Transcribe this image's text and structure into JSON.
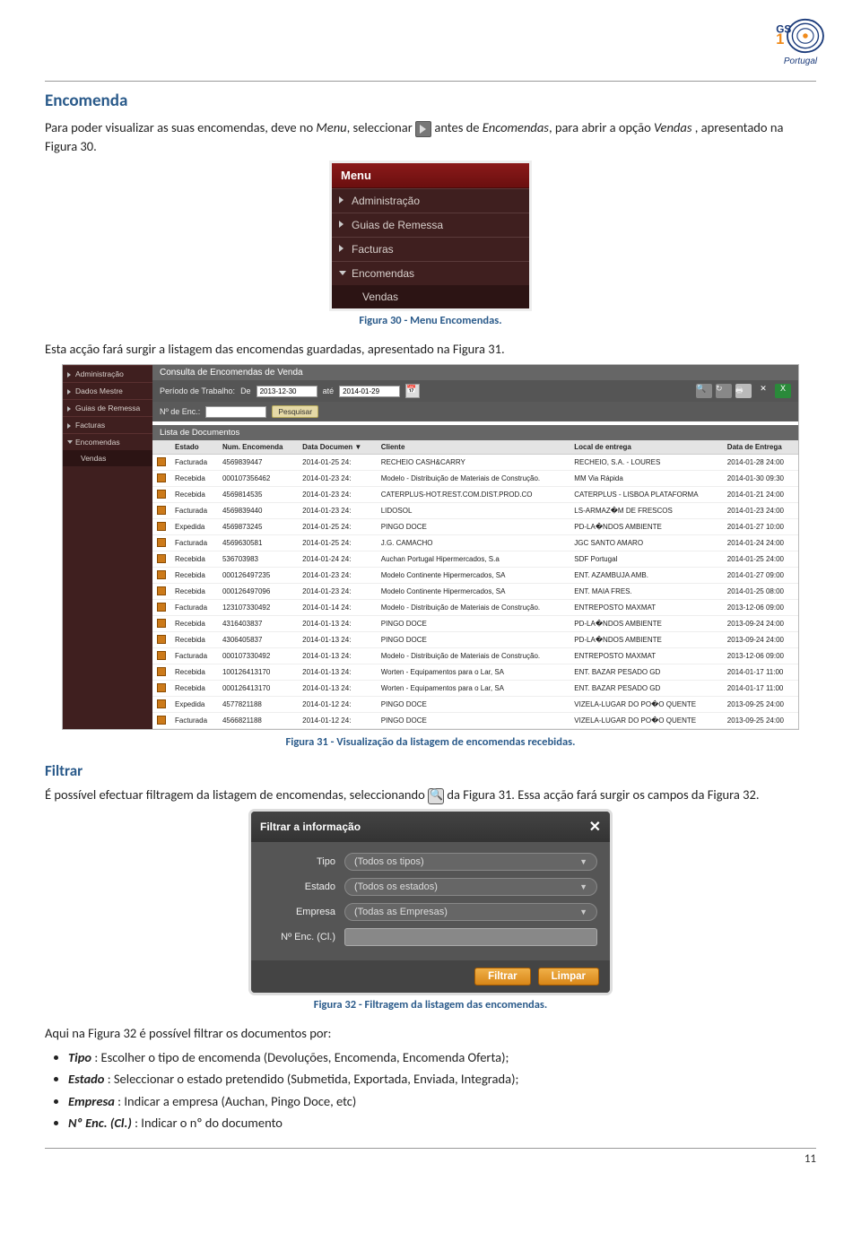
{
  "logo": {
    "brand": "GS1",
    "country": "Portugal"
  },
  "h_encomenda": "Encomenda",
  "p1_a": "Para poder visualizar as suas encomendas, deve no ",
  "p1_menu": "Menu",
  "p1_b": ", seleccionar ",
  "p1_c": " antes de ",
  "p1_enc": "Encomendas",
  "p1_d": ", para abrir a opção ",
  "p1_vendas": "Vendas ",
  "p1_e": ", apresentado na Figura 30.",
  "menu": {
    "title": "Menu",
    "items": [
      "Administração",
      "Guias de Remessa",
      "Facturas",
      "Encomendas"
    ],
    "sub": "Vendas"
  },
  "cap30": "Figura 30 - Menu Encomendas.",
  "p2": "Esta acção fará surgir a listagem das encomendas guardadas, apresentado na Figura 31.",
  "listing": {
    "title": "Consulta de Encomendas de Venda",
    "periodo_lbl": "Período de Trabalho:",
    "de_lbl": "De",
    "de_val": "2013-12-30",
    "ate_lbl": "até",
    "ate_val": "2014-01-29",
    "nenc_lbl": "Nº de Enc.:",
    "btn": "Pesquisar",
    "list_head": "Lista de Documentos",
    "cols": [
      "Estado",
      "Num. Encomenda",
      "Data Documen ▼",
      "Cliente",
      "Local de entrega",
      "Data de Entrega"
    ],
    "side": [
      "Administração",
      "Dados Mestre",
      "Guias de Remessa",
      "Facturas",
      "Encomendas"
    ],
    "side_sub": "Vendas",
    "rows": [
      [
        "Facturada",
        "4569839447",
        "2014-01-25 24:",
        "RECHEIO CASH&CARRY",
        "RECHEIO, S.A. - LOURES",
        "2014-01-28 24:00"
      ],
      [
        "Recebida",
        "000107356462",
        "2014-01-23 24:",
        "Modelo - Distribuição de Materiais de Construção.",
        "MM Via Rápida",
        "2014-01-30 09:30"
      ],
      [
        "Recebida",
        "4569814535",
        "2014-01-23 24:",
        "CATERPLUS-HOT.REST.COM.DIST.PROD.CO",
        "CATERPLUS - LISBOA PLATAFORMA",
        "2014-01-21 24:00"
      ],
      [
        "Facturada",
        "4569839440",
        "2014-01-23 24:",
        "LIDOSOL",
        "LS-ARMAZ�M DE FRESCOS",
        "2014-01-23 24:00"
      ],
      [
        "Expedida",
        "4569873245",
        "2014-01-25 24:",
        "PINGO DOCE",
        "PD-LA�NDOS AMBIENTE",
        "2014-01-27 10:00"
      ],
      [
        "Facturada",
        "4569630581",
        "2014-01-25 24:",
        "J.G. CAMACHO",
        "JGC SANTO AMARO",
        "2014-01-24 24:00"
      ],
      [
        "Recebida",
        "536703983",
        "2014-01-24 24:",
        "Auchan Portugal Hipermercados, S.a",
        "SDF Portugal",
        "2014-01-25 24:00"
      ],
      [
        "Recebida",
        "000126497235",
        "2014-01-23 24:",
        "Modelo Continente Hipermercados, SA",
        "ENT. AZAMBUJA AMB.",
        "2014-01-27 09:00"
      ],
      [
        "Recebida",
        "000126497096",
        "2014-01-23 24:",
        "Modelo Continente Hipermercados, SA",
        "ENT. MAIA FRES.",
        "2014-01-25 08:00"
      ],
      [
        "Facturada",
        "123107330492",
        "2014-01-14 24:",
        "Modelo - Distribuição de Materiais de Construção.",
        "ENTREPOSTO MAXMAT",
        "2013-12-06 09:00"
      ],
      [
        "Recebida",
        "4316403837",
        "2014-01-13 24:",
        "PINGO DOCE",
        "PD-LA�NDOS AMBIENTE",
        "2013-09-24 24:00"
      ],
      [
        "Recebida",
        "4306405837",
        "2014-01-13 24:",
        "PINGO DOCE",
        "PD-LA�NDOS AMBIENTE",
        "2013-09-24 24:00"
      ],
      [
        "Facturada",
        "000107330492",
        "2014-01-13 24:",
        "Modelo - Distribuição de Materiais de Construção.",
        "ENTREPOSTO MAXMAT",
        "2013-12-06 09:00"
      ],
      [
        "Recebida",
        "100126413170",
        "2014-01-13 24:",
        "Worten - Equipamentos para o Lar, SA",
        "ENT. BAZAR PESADO GD",
        "2014-01-17 11:00"
      ],
      [
        "Recebida",
        "000126413170",
        "2014-01-13 24:",
        "Worten - Equipamentos para o Lar, SA",
        "ENT. BAZAR PESADO GD",
        "2014-01-17 11:00"
      ],
      [
        "Expedida",
        "4577821188",
        "2014-01-12 24:",
        "PINGO DOCE",
        "VIZELA-LUGAR DO PO�O QUENTE",
        "2013-09-25 24:00"
      ],
      [
        "Facturada",
        "4566821188",
        "2014-01-12 24:",
        "PINGO DOCE",
        "VIZELA-LUGAR DO PO�O QUENTE",
        "2013-09-25 24:00"
      ]
    ]
  },
  "cap31": "Figura 31 - Visualização da listagem de encomendas recebidas.",
  "h_filtrar": "Filtrar",
  "p3_a": "É possível efectuar filtragem da listagem de encomendas, seleccionando ",
  "p3_b": " da Figura 31. Essa acção fará surgir os campos da Figura 32.",
  "dialog": {
    "title": "Filtrar a informação",
    "tipo_lbl": "Tipo",
    "tipo_val": "(Todos os tipos)",
    "estado_lbl": "Estado",
    "estado_val": "(Todos os estados)",
    "empresa_lbl": "Empresa",
    "empresa_val": "(Todas as Empresas)",
    "nenc_lbl": "Nº Enc. (Cl.)",
    "filtrar": "Filtrar",
    "limpar": "Limpar"
  },
  "cap32": "Figura 32 - Filtragem da listagem das encomendas.",
  "p4": "Aqui na Figura 32 é possível filtrar os documentos por:",
  "bullets": {
    "b1_k": "Tipo",
    "b1_v": " : Escolher o tipo de encomenda (Devoluções, Encomenda, Encomenda Oferta);",
    "b2_k": "Estado",
    "b2_v": " : Seleccionar o estado pretendido (Submetida, Exportada, Enviada, Integrada);",
    "b3_k": "Empresa",
    "b3_v": " : Indicar a empresa (Auchan, Pingo Doce, etc)",
    "b4_k": "Nº Enc. (Cl.)",
    "b4_v": " : Indicar o nº do documento"
  },
  "page_num": "11"
}
